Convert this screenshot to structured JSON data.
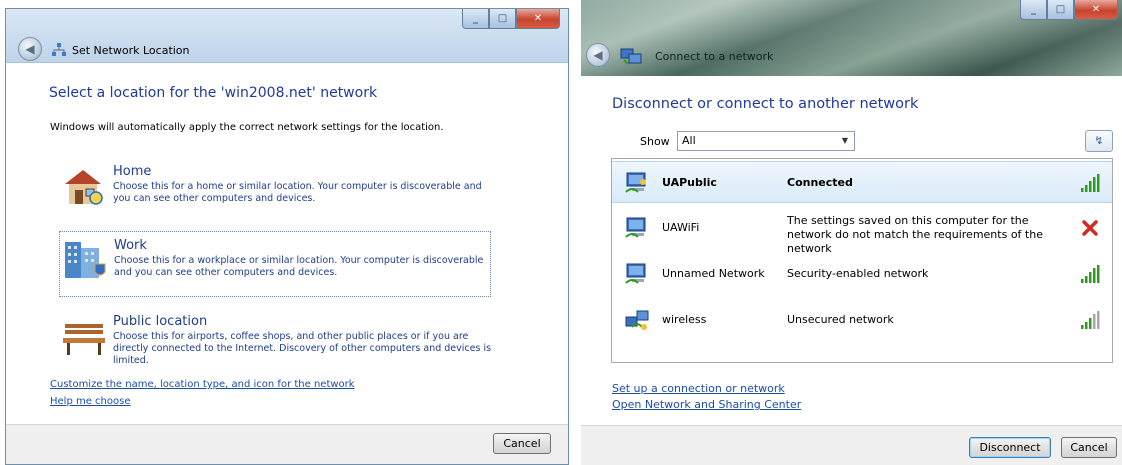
{
  "left_window": {
    "title": "Set Network Location",
    "heading": "Select a location for the 'win2008.net' network",
    "intro": "Windows will automatically apply the correct network settings for the location.",
    "options": [
      {
        "title": "Home",
        "description": "Choose this for a home or similar location. Your computer is discoverable and you can see other computers and devices.",
        "icon": "house-icon"
      },
      {
        "title": "Work",
        "description": "Choose this for a workplace or similar location. Your computer is discoverable and you can see other computers and devices.",
        "icon": "office-building-icon"
      },
      {
        "title": "Public location",
        "description": "Choose this for airports, coffee shops, and other public places or if you are directly connected to the Internet. Discovery of other computers and devices is limited.",
        "icon": "park-bench-icon"
      }
    ],
    "links": {
      "customize": "Customize the name, location type, and icon for the network",
      "help": "Help me choose"
    },
    "cancel_label": "Cancel"
  },
  "right_window": {
    "title": "Connect to a network",
    "heading": "Disconnect or connect to another network",
    "show_label": "Show",
    "show_value": "All",
    "networks": [
      {
        "name": "UAPublic",
        "status": "Connected",
        "signal": "full-signal-icon",
        "selected": true
      },
      {
        "name": "UAWiFi",
        "status": "The settings saved on this computer for the network do not match the requirements of the network",
        "signal": "error-x-icon"
      },
      {
        "name": "Unnamed Network",
        "status": "Security-enabled network",
        "signal": "full-signal-icon"
      },
      {
        "name": "wireless",
        "status": "Unsecured network",
        "signal": "partial-signal-icon"
      }
    ],
    "links": {
      "setup": "Set up a connection or network",
      "open_center": "Open Network and Sharing Center"
    },
    "disconnect_label": "Disconnect",
    "cancel_label": "Cancel"
  },
  "colors": {
    "heading_blue": "#1f3a9a",
    "link_blue": "#1a4ea8",
    "signal_green": "#2e9a1e",
    "error_red": "#d22a1e"
  }
}
